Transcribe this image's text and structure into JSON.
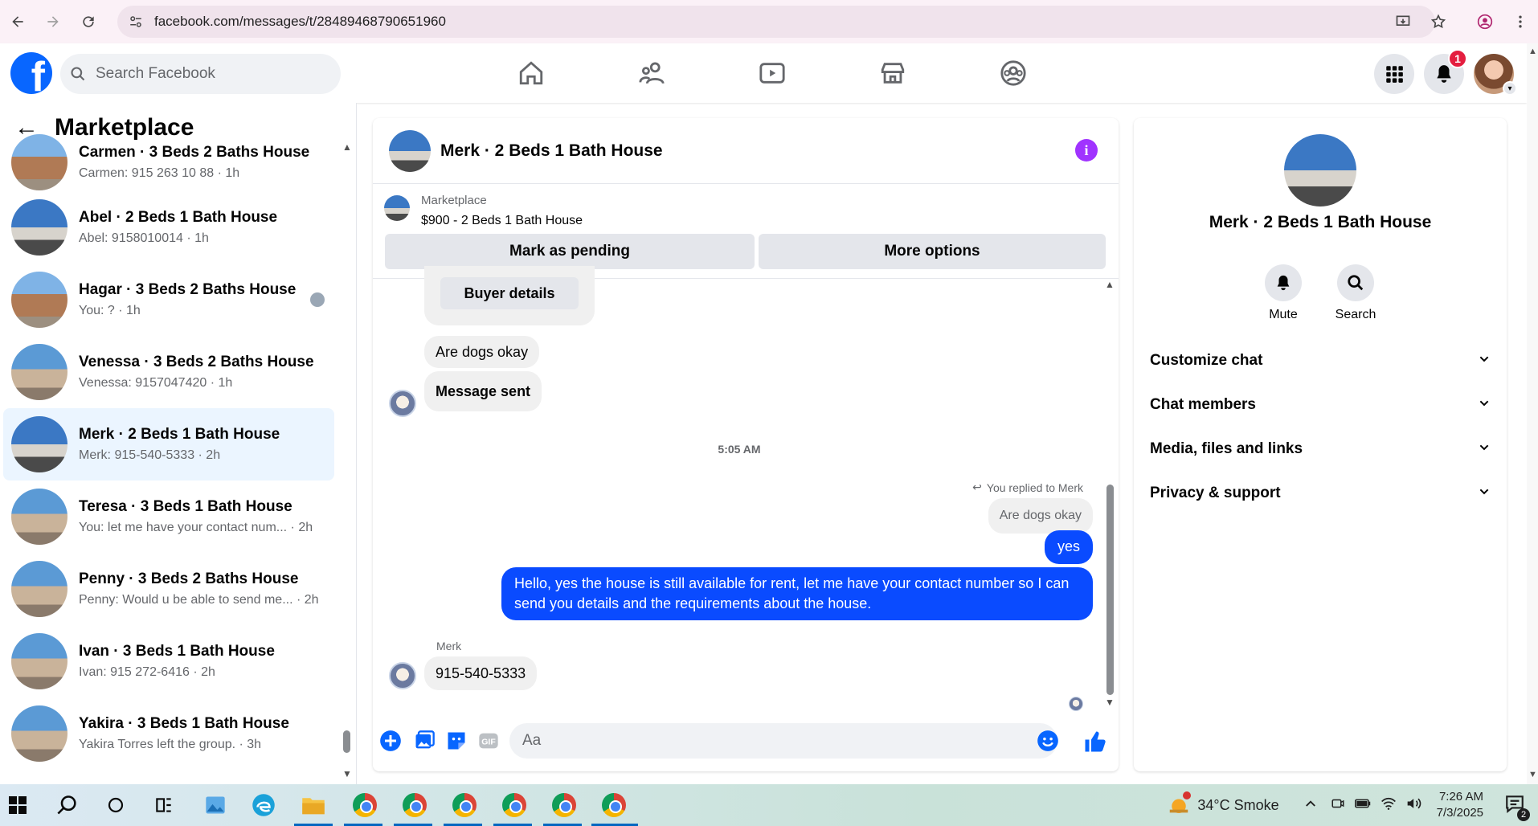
{
  "browser": {
    "url": "facebook.com/messages/t/28489468790651960"
  },
  "fb_nav": {
    "logo_letter": "f",
    "search_placeholder": "Search Facebook",
    "notification_count": "1"
  },
  "sidebar": {
    "title": "Marketplace",
    "conversations": [
      {
        "title": "Carmen · 3 Beds 2 Baths House",
        "subtitle": "Carmen: 915 263 10 88 · 1h"
      },
      {
        "title": "Abel · 2 Beds 1 Bath House",
        "subtitle": "Abel: 9158010014 · 1h"
      },
      {
        "title": "Hagar · 3 Beds 2 Baths House",
        "subtitle": "You: ? · 1h"
      },
      {
        "title": "Venessa · 3 Beds 2 Baths House",
        "subtitle": "Venessa: 9157047420 · 1h"
      },
      {
        "title": "Merk · 2 Beds 1 Bath House",
        "subtitle": "Merk: 915-540-5333 · 2h"
      },
      {
        "title": "Teresa · 3 Beds 1 Bath House",
        "subtitle": "You: let me have your contact num... · 2h"
      },
      {
        "title": "Penny · 3 Beds 2 Baths House",
        "subtitle": "Penny: Would u be able to send me... · 2h"
      },
      {
        "title": "Ivan · 3 Beds 1 Bath House",
        "subtitle": "Ivan: 915 272-6416 · 2h"
      },
      {
        "title": "Yakira · 3 Beds 1 Bath House",
        "subtitle": "Yakira Torres left the group. · 3h"
      }
    ]
  },
  "chat": {
    "name": "Merk · 2 Beds 1 Bath House",
    "info_glyph": "i",
    "listing_category": "Marketplace",
    "listing_price": "$900 - 2 Beds 1 Bath House",
    "mark_pending_label": "Mark as pending",
    "more_options_label": "More options",
    "messages": {
      "buyer_details": "Buyer details",
      "are_dogs_okay": "Are dogs okay",
      "message_sent": "Message sent",
      "timestamp": "5:05 AM",
      "replied_to": "You replied to Merk",
      "quoted": "Are dogs okay",
      "yes": "yes",
      "long_reply": "Hello, yes the house is still available for rent, let me have your contact number so I can send you details and the requirements about the house.",
      "sender_name": "Merk",
      "phone": "915-540-5333"
    },
    "composer_placeholder": "Aa"
  },
  "info_panel": {
    "name": "Merk · 2 Beds 1 Bath House",
    "mute_label": "Mute",
    "search_label": "Search",
    "rows": [
      "Customize chat",
      "Chat members",
      "Media, files and links",
      "Privacy & support"
    ]
  },
  "taskbar": {
    "weather": "34°C  Smoke",
    "time": "7:26 AM",
    "date": "7/3/2025",
    "notif_count": "2"
  },
  "colors": {
    "fb_blue": "#0866ff",
    "message_blue": "#0a4bff",
    "info_purple": "#a033ff",
    "active_row": "#ebf5ff"
  }
}
